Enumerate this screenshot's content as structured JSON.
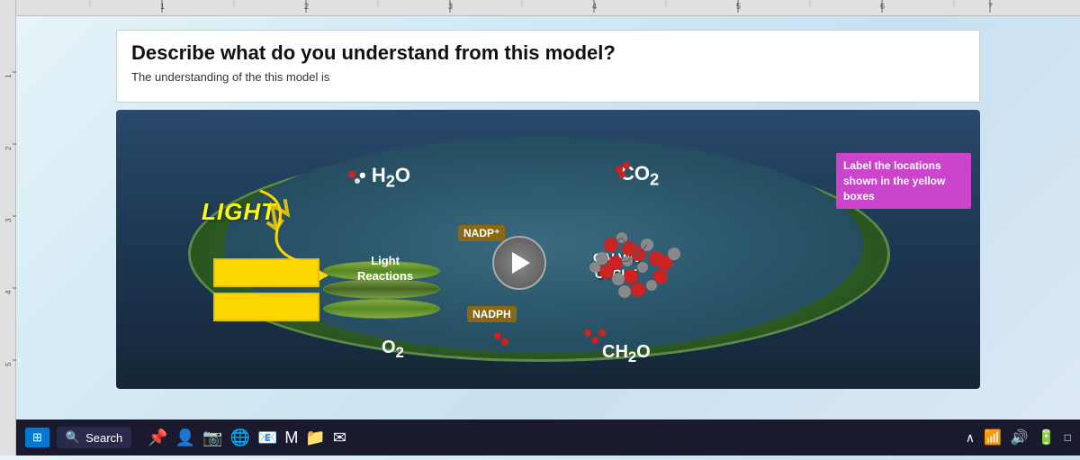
{
  "ruler": {
    "top_label": "ruler-top",
    "left_label": "ruler-left"
  },
  "question_card": {
    "title": "Describe what do you understand from this model?",
    "subtitle": "The understanding of the this model is"
  },
  "diagram": {
    "light_label": "LIGHT",
    "h2o_label": "H₂O",
    "co2_label": "CO₂",
    "nadp_label": "NADP⁺",
    "nadph_label": "NADPH",
    "light_reactions_label": "Light\nReactions",
    "calvin_cycle_label": "CALVIN\nCYCLE",
    "o2_label": "O₂",
    "ch2o_label": "CH₂O"
  },
  "label_box": {
    "text": "Label the locations shown in the yellow boxes"
  },
  "taskbar": {
    "search_placeholder": "Search",
    "search_icon": "🔍",
    "icons": [
      "⬛",
      "🔊",
      "□"
    ]
  }
}
